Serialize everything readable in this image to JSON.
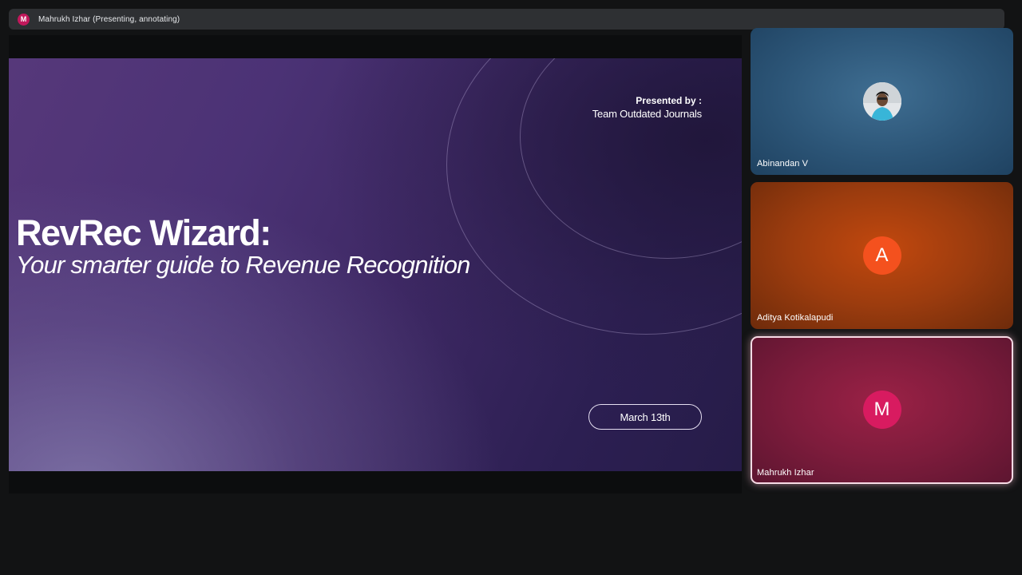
{
  "presenter_bar": {
    "avatar_letter": "M",
    "status_text": "Mahrukh Izhar (Presenting, annotating)"
  },
  "slide": {
    "presented_by_label": "Presented by :",
    "team_name": "Team Outdated Journals",
    "title": "RevRec Wizard:",
    "subtitle": "Your smarter guide to Revenue Recognition",
    "date": "March 13th"
  },
  "participants": [
    {
      "name": "Abinandan V",
      "avatar": "",
      "avatar_type": "photo",
      "color": "#2c5577"
    },
    {
      "name": "Aditya Kotikalapudi",
      "avatar": "A",
      "avatar_type": "letter",
      "color": "#f4511e"
    },
    {
      "name": "Mahrukh Izhar",
      "avatar": "M",
      "avatar_type": "letter",
      "color": "#d81b60",
      "active_speaker": true
    }
  ]
}
